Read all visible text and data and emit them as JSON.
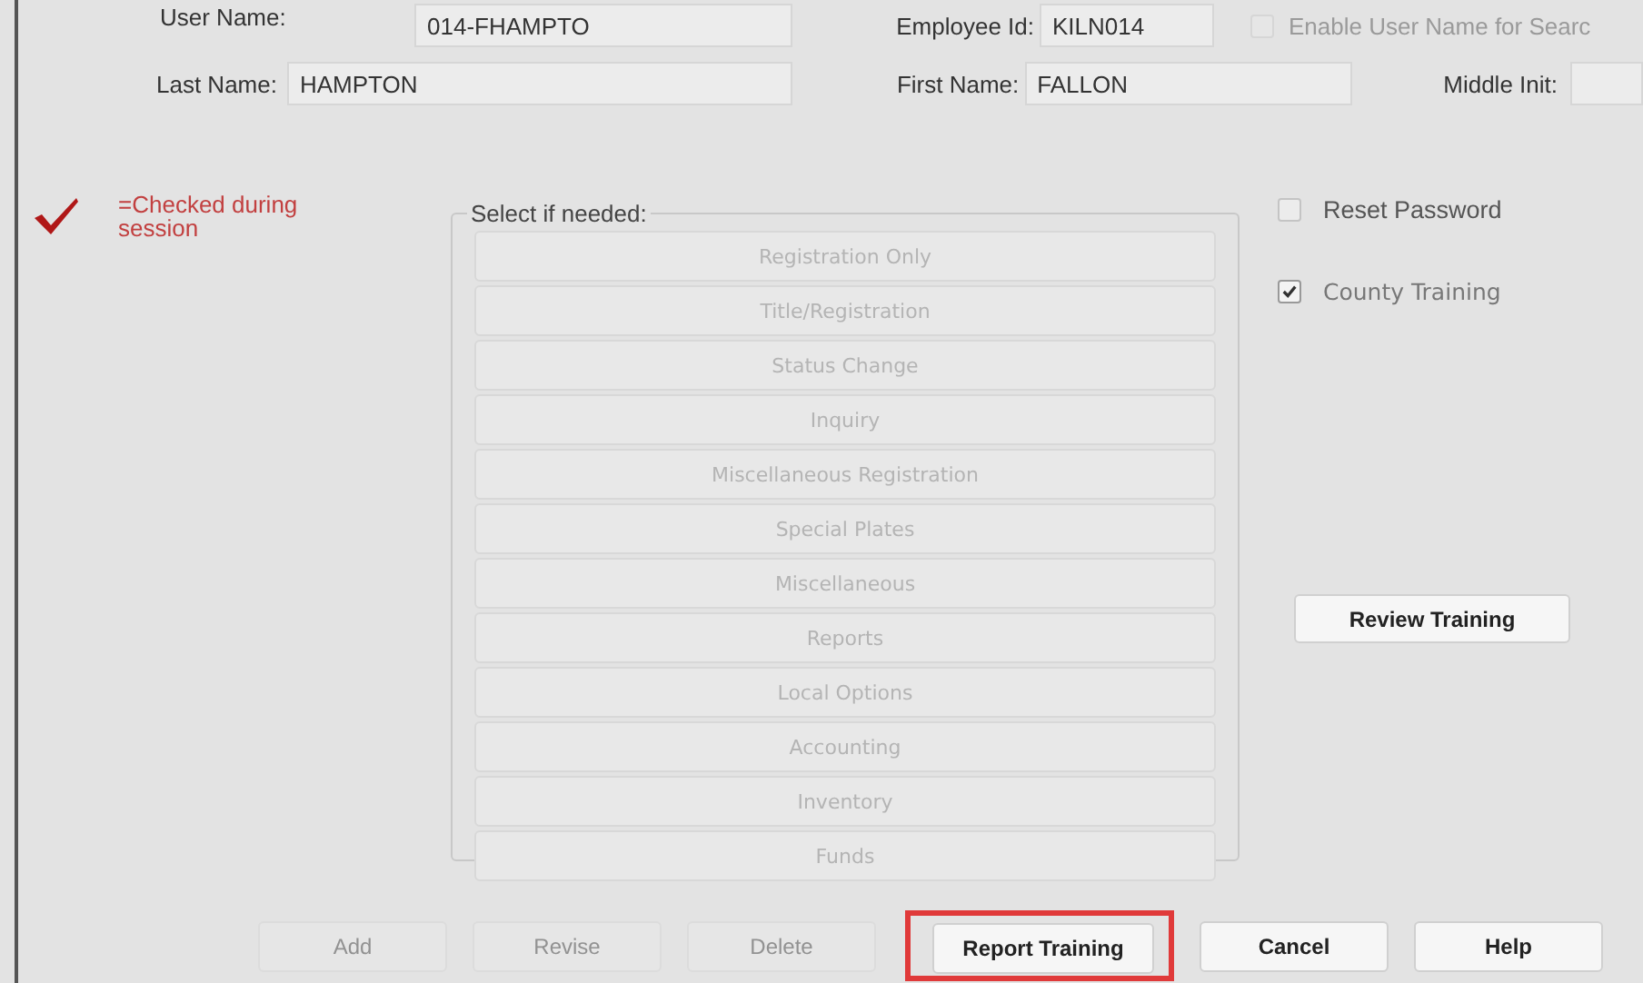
{
  "header": {
    "user_name": {
      "label": "User Name:",
      "value": "014-FHAMPTO"
    },
    "employee_id": {
      "label": "Employee Id:",
      "value": "KILN014"
    },
    "enable_search": {
      "label": "Enable User Name for Searc",
      "checked": false,
      "disabled": true
    },
    "last_name": {
      "label": "Last Name:",
      "value": "HAMPTON"
    },
    "first_name": {
      "label": "First Name:",
      "value": "FALLON"
    },
    "middle_init": {
      "label": "Middle Init:"
    }
  },
  "legend": {
    "text": "=Checked during session"
  },
  "group": {
    "title": "Select if needed:",
    "buttons": [
      {
        "label": "Registration Only",
        "disabled": true
      },
      {
        "label": "Title/Registration",
        "disabled": true
      },
      {
        "label": "Status Change",
        "disabled": true
      },
      {
        "label": "Inquiry",
        "disabled": true
      },
      {
        "label": "Miscellaneous Registration",
        "disabled": true
      },
      {
        "label": "Special Plates",
        "disabled": true
      },
      {
        "label": "Miscellaneous",
        "disabled": true
      },
      {
        "label": "Reports",
        "disabled": true
      },
      {
        "label": "Local Options",
        "disabled": true
      },
      {
        "label": "Accounting",
        "disabled": true
      },
      {
        "label": "Inventory",
        "disabled": true
      },
      {
        "label": "Funds",
        "disabled": true
      }
    ]
  },
  "options": [
    {
      "label": "Reset Password",
      "checked": false,
      "disabled": false
    },
    {
      "label": "County Training",
      "checked": true,
      "disabled": false
    }
  ],
  "review_button": {
    "label": "Review Training",
    "disabled": false
  },
  "footer_buttons": [
    {
      "label": "Add",
      "disabled": true,
      "highlighted": false
    },
    {
      "label": "Revise",
      "disabled": true,
      "highlighted": false
    },
    {
      "label": "Delete",
      "disabled": true,
      "highlighted": false
    },
    {
      "label": "Report Training",
      "disabled": false,
      "highlighted": true
    },
    {
      "label": "Cancel",
      "disabled": false,
      "highlighted": false
    },
    {
      "label": "Help",
      "disabled": false,
      "highlighted": false
    }
  ]
}
